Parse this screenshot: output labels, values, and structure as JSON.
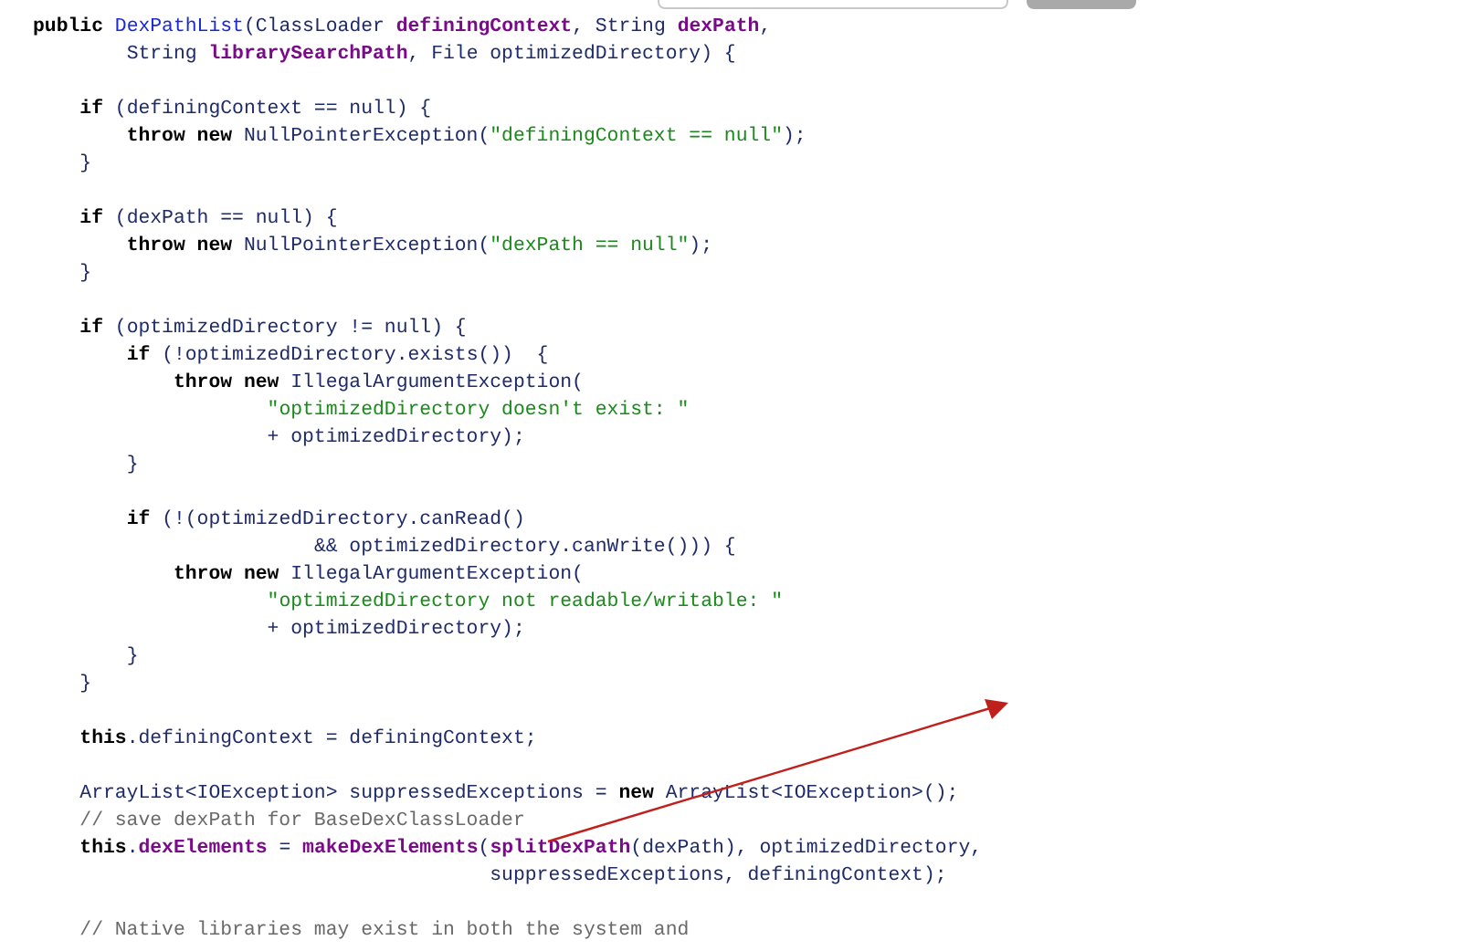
{
  "code_blocks": [
    {
      "lines": [
        {
          "tokens": [
            {
              "kind": "keyword",
              "text": "public "
            },
            {
              "kind": "declaration",
              "text": "DexPathList"
            },
            {
              "kind": "plain",
              "text": "(ClassLoader "
            },
            {
              "kind": "field",
              "text": "definingContext"
            },
            {
              "kind": "plain",
              "text": ", String "
            },
            {
              "kind": "field",
              "text": "dexPath"
            },
            {
              "kind": "plain",
              "text": ","
            }
          ]
        },
        {
          "tokens": [
            {
              "kind": "plain",
              "text": "        String "
            },
            {
              "kind": "field",
              "text": "librarySearchPath"
            },
            {
              "kind": "plain",
              "text": ", File optimizedDirectory) {"
            }
          ]
        }
      ]
    },
    {
      "lines": [
        {
          "tokens": [
            {
              "kind": "keyword",
              "text": "    if "
            },
            {
              "kind": "plain",
              "text": "(definingContext == null) {"
            }
          ]
        },
        {
          "tokens": [
            {
              "kind": "keyword",
              "text": "        throw new "
            },
            {
              "kind": "plain",
              "text": "NullPointerException("
            },
            {
              "kind": "string",
              "text": "\"definingContext == null\""
            },
            {
              "kind": "plain",
              "text": ");"
            }
          ]
        },
        {
          "tokens": [
            {
              "kind": "plain",
              "text": "    }"
            }
          ]
        }
      ]
    },
    {
      "lines": [
        {
          "tokens": [
            {
              "kind": "keyword",
              "text": "    if "
            },
            {
              "kind": "plain",
              "text": "(dexPath == null) {"
            }
          ]
        },
        {
          "tokens": [
            {
              "kind": "keyword",
              "text": "        throw new "
            },
            {
              "kind": "plain",
              "text": "NullPointerException("
            },
            {
              "kind": "string",
              "text": "\"dexPath == null\""
            },
            {
              "kind": "plain",
              "text": ");"
            }
          ]
        },
        {
          "tokens": [
            {
              "kind": "plain",
              "text": "    }"
            }
          ]
        }
      ]
    },
    {
      "lines": [
        {
          "tokens": [
            {
              "kind": "keyword",
              "text": "    if "
            },
            {
              "kind": "plain",
              "text": "(optimizedDirectory != null) {"
            }
          ]
        },
        {
          "tokens": [
            {
              "kind": "keyword",
              "text": "        if "
            },
            {
              "kind": "plain",
              "text": "(!optimizedDirectory.exists())  {"
            }
          ]
        },
        {
          "tokens": [
            {
              "kind": "keyword",
              "text": "            throw new "
            },
            {
              "kind": "plain",
              "text": "IllegalArgumentException("
            }
          ]
        },
        {
          "tokens": [
            {
              "kind": "string",
              "text": "                    \"optimizedDirectory doesn't exist: \""
            }
          ]
        },
        {
          "tokens": [
            {
              "kind": "plain",
              "text": "                    + optimizedDirectory);"
            }
          ]
        },
        {
          "tokens": [
            {
              "kind": "plain",
              "text": "        }"
            }
          ]
        }
      ]
    },
    {
      "lines": [
        {
          "tokens": [
            {
              "kind": "keyword",
              "text": "        if "
            },
            {
              "kind": "plain",
              "text": "(!(optimizedDirectory.canRead()"
            }
          ]
        },
        {
          "tokens": [
            {
              "kind": "plain",
              "text": "                        && optimizedDirectory.canWrite())) {"
            }
          ]
        },
        {
          "tokens": [
            {
              "kind": "keyword",
              "text": "            throw new "
            },
            {
              "kind": "plain",
              "text": "IllegalArgumentException("
            }
          ]
        },
        {
          "tokens": [
            {
              "kind": "string",
              "text": "                    \"optimizedDirectory not readable/writable: \""
            }
          ]
        },
        {
          "tokens": [
            {
              "kind": "plain",
              "text": "                    + optimizedDirectory);"
            }
          ]
        },
        {
          "tokens": [
            {
              "kind": "plain",
              "text": "        }"
            }
          ]
        },
        {
          "tokens": [
            {
              "kind": "plain",
              "text": "    }"
            }
          ]
        }
      ]
    },
    {
      "lines": [
        {
          "tokens": [
            {
              "kind": "keyword",
              "text": "    this"
            },
            {
              "kind": "plain",
              "text": ".definingContext = definingContext;"
            }
          ]
        }
      ]
    },
    {
      "lines": [
        {
          "tokens": [
            {
              "kind": "plain",
              "text": "    ArrayList<IOException> suppressedExceptions = "
            },
            {
              "kind": "keyword",
              "text": "new "
            },
            {
              "kind": "plain",
              "text": "ArrayList<IOException>();"
            }
          ]
        },
        {
          "tokens": [
            {
              "kind": "comment",
              "text": "    // save dexPath for BaseDexClassLoader"
            }
          ]
        },
        {
          "tokens": [
            {
              "kind": "keyword",
              "text": "    this"
            },
            {
              "kind": "plain",
              "text": "."
            },
            {
              "kind": "field",
              "text": "dexElements"
            },
            {
              "kind": "plain",
              "text": " = "
            },
            {
              "kind": "field",
              "text": "makeDexElements"
            },
            {
              "kind": "plain",
              "text": "("
            },
            {
              "kind": "field",
              "text": "splitDexPath"
            },
            {
              "kind": "plain",
              "text": "(dexPath), optimizedDirectory,"
            }
          ]
        },
        {
          "tokens": [
            {
              "kind": "plain",
              "text": "                                       suppressedExceptions, definingContext);"
            }
          ]
        }
      ]
    },
    {
      "lines": [
        {
          "tokens": [
            {
              "kind": "comment",
              "text": "    // Native libraries may exist in both the system and"
            }
          ]
        }
      ]
    }
  ]
}
